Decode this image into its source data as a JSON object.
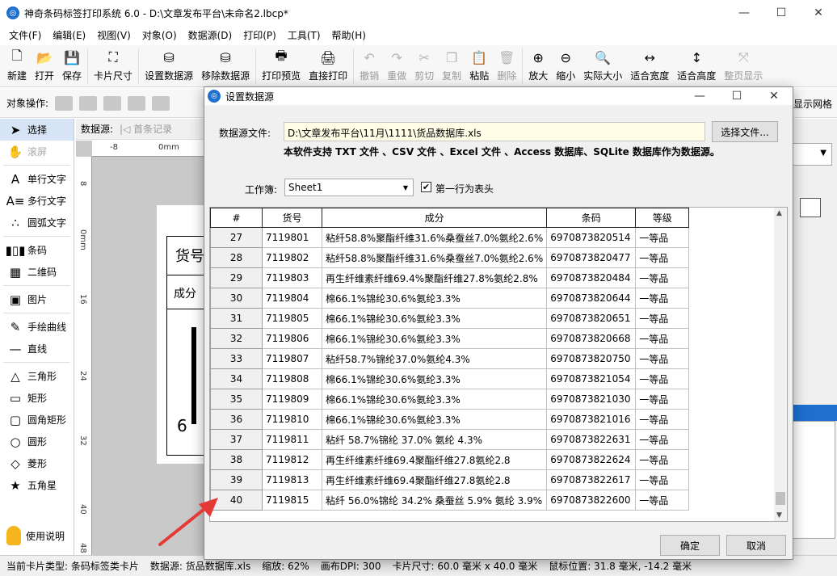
{
  "window": {
    "title": "神奇条码标签打印系统 6.0 - D:\\文章发布平台\\未命名2.lbcp*",
    "controls": [
      "—",
      "☐",
      "✕"
    ]
  },
  "menu": [
    "文件(F)",
    "编辑(E)",
    "视图(V)",
    "对象(O)",
    "数据源(D)",
    "打印(P)",
    "工具(T)",
    "帮助(H)"
  ],
  "toolbar": [
    {
      "label": "新建",
      "icon": "new-file-icon",
      "glyph": "🗋",
      "enabled": true
    },
    {
      "label": "打开",
      "icon": "open-icon",
      "glyph": "📂",
      "enabled": true
    },
    {
      "label": "保存",
      "icon": "save-icon",
      "glyph": "💾",
      "enabled": true
    },
    {
      "label": "卡片尺寸",
      "icon": "card-size-icon",
      "glyph": "⛶",
      "enabled": true
    },
    {
      "label": "设置数据源",
      "icon": "set-datasource-icon",
      "glyph": "⛁",
      "enabled": true
    },
    {
      "label": "移除数据源",
      "icon": "remove-datasource-icon",
      "glyph": "⛁",
      "enabled": true
    },
    {
      "label": "打印预览",
      "icon": "print-preview-icon",
      "glyph": "🖶",
      "enabled": true
    },
    {
      "label": "直接打印",
      "icon": "print-icon",
      "glyph": "🖨",
      "enabled": true
    },
    {
      "label": "撤销",
      "icon": "undo-icon",
      "glyph": "↶",
      "enabled": false
    },
    {
      "label": "重做",
      "icon": "redo-icon",
      "glyph": "↷",
      "enabled": false
    },
    {
      "label": "剪切",
      "icon": "cut-icon",
      "glyph": "✂",
      "enabled": false
    },
    {
      "label": "复制",
      "icon": "copy-icon",
      "glyph": "❐",
      "enabled": false
    },
    {
      "label": "粘贴",
      "icon": "paste-icon",
      "glyph": "📋",
      "enabled": true
    },
    {
      "label": "删除",
      "icon": "delete-icon",
      "glyph": "🗑",
      "enabled": false
    },
    {
      "label": "放大",
      "icon": "zoom-in-icon",
      "glyph": "⊕",
      "enabled": true
    },
    {
      "label": "缩小",
      "icon": "zoom-out-icon",
      "glyph": "⊖",
      "enabled": true
    },
    {
      "label": "实际大小",
      "icon": "actual-size-icon",
      "glyph": "🔍",
      "enabled": true
    },
    {
      "label": "适合宽度",
      "icon": "fit-width-icon",
      "glyph": "↔",
      "enabled": true
    },
    {
      "label": "适合高度",
      "icon": "fit-height-icon",
      "glyph": "↕",
      "enabled": true
    },
    {
      "label": "整页显示",
      "icon": "full-page-icon",
      "glyph": "⤧",
      "enabled": false
    }
  ],
  "objbar": {
    "label": "对象操作:",
    "right_label": "显示网格"
  },
  "left_panel": [
    {
      "label": "选择",
      "icon": "select-arrow-icon",
      "glyph": "➤",
      "active": true
    },
    {
      "label": "滚屏",
      "icon": "hand-pan-icon",
      "glyph": "✋",
      "dim": true
    },
    {
      "label": "单行文字",
      "icon": "single-line-text-icon",
      "glyph": "A"
    },
    {
      "label": "多行文字",
      "icon": "multi-line-text-icon",
      "glyph": "A≡"
    },
    {
      "label": "圆弧文字",
      "icon": "arc-text-icon",
      "glyph": "∴"
    },
    {
      "label": "条码",
      "icon": "barcode-icon",
      "glyph": "▮▯▮"
    },
    {
      "label": "二维码",
      "icon": "qrcode-icon",
      "glyph": "▦"
    },
    {
      "label": "图片",
      "icon": "image-icon",
      "glyph": "▣"
    },
    {
      "label": "手绘曲线",
      "icon": "freehand-curve-icon",
      "glyph": "✎"
    },
    {
      "label": "直线",
      "icon": "line-icon",
      "glyph": "—"
    },
    {
      "label": "三角形",
      "icon": "triangle-icon",
      "glyph": "△"
    },
    {
      "label": "矩形",
      "icon": "rectangle-icon",
      "glyph": "▭"
    },
    {
      "label": "圆角矩形",
      "icon": "rounded-rectangle-icon",
      "glyph": "▢"
    },
    {
      "label": "圆形",
      "icon": "circle-icon",
      "glyph": "○"
    },
    {
      "label": "菱形",
      "icon": "diamond-icon",
      "glyph": "◇"
    },
    {
      "label": "五角星",
      "icon": "star-icon",
      "glyph": "★"
    }
  ],
  "help_label": "使用说明",
  "datasource_bar": {
    "label": "数据源:",
    "first_record": "首条记录"
  },
  "ruler": {
    "top": [
      "-8",
      "0mm"
    ],
    "left": [
      "8",
      "0mm",
      "16",
      "24",
      "32",
      "40",
      "48"
    ]
  },
  "label_preview": {
    "row1": "货号",
    "row2": "成分",
    "num": "6"
  },
  "status": {
    "card_type": "当前卡片类型: 条码标签类卡片",
    "datasource": "数据源: 货品数据库.xls",
    "zoom": "缩放: 62%",
    "dpi": "画布DPI: 300",
    "card_size": "卡片尺寸: 60.0 毫米 x 40.0 毫米",
    "mouse": "鼠标位置: 31.8 毫米, -14.2 毫米"
  },
  "dialog": {
    "title": "设置数据源",
    "file_label": "数据源文件:",
    "file_path": "D:\\文章发布平台\\11月\\1111\\货品数据库.xls",
    "choose_button": "选择文件...",
    "note": "本软件支持 TXT 文件 、CSV 文件 、Excel 文件 、Access 数据库、SQLite 数据库作为数据源。",
    "workbook_label": "工作簿:",
    "workbook_value": "Sheet1",
    "first_row_header_label": "第一行为表头",
    "first_row_header_checked": true,
    "ok": "确定",
    "cancel": "取消",
    "columns": [
      "#",
      "货号",
      "成分",
      "条码",
      "等级"
    ],
    "rows": [
      [
        "27",
        "7119801",
        "粘纤58.8%聚酯纤维31.6%桑蚕丝7.0%氨纶2.6%",
        "6970873820514",
        "一等品"
      ],
      [
        "28",
        "7119802",
        "粘纤58.8%聚酯纤维31.6%桑蚕丝7.0%氨纶2.6%",
        "6970873820477",
        "一等品"
      ],
      [
        "29",
        "7119803",
        "再生纤维素纤维69.4%聚酯纤维27.8%氨纶2.8%",
        "6970873820484",
        "一等品"
      ],
      [
        "30",
        "7119804",
        "棉66.1%锦纶30.6%氨纶3.3%",
        "6970873820644",
        "一等品"
      ],
      [
        "31",
        "7119805",
        "棉66.1%锦纶30.6%氨纶3.3%",
        "6970873820651",
        "一等品"
      ],
      [
        "32",
        "7119806",
        "棉66.1%锦纶30.6%氨纶3.3%",
        "6970873820668",
        "一等品"
      ],
      [
        "33",
        "7119807",
        "粘纤58.7%锦纶37.0%氨纶4.3%",
        "6970873820750",
        "一等品"
      ],
      [
        "34",
        "7119808",
        "棉66.1%锦纶30.6%氨纶3.3%",
        "6970873821054",
        "一等品"
      ],
      [
        "35",
        "7119809",
        "棉66.1%锦纶30.6%氨纶3.3%",
        "6970873821030",
        "一等品"
      ],
      [
        "36",
        "7119810",
        "棉66.1%锦纶30.6%氨纶3.3%",
        "6970873821016",
        "一等品"
      ],
      [
        "37",
        "7119811",
        "粘纤 58.7%锦纶 37.0% 氨纶 4.3%",
        "6970873822631",
        "一等品"
      ],
      [
        "38",
        "7119812",
        "再生纤维素纤维69.4聚酯纤维27.8氨纶2.8",
        "6970873822624",
        "一等品"
      ],
      [
        "39",
        "7119813",
        "再生纤维素纤维69.4聚酯纤维27.8氨纶2.8",
        "6970873822617",
        "一等品"
      ],
      [
        "40",
        "7119815",
        "粘纤 56.0%锦纶 34.2% 桑蚕丝 5.9% 氨纶 3.9%",
        "6970873822600",
        "一等品"
      ]
    ]
  },
  "colors": {
    "accent": "#1e6fd0",
    "arrow": "#e53935",
    "file_bg": "#fffde6"
  }
}
